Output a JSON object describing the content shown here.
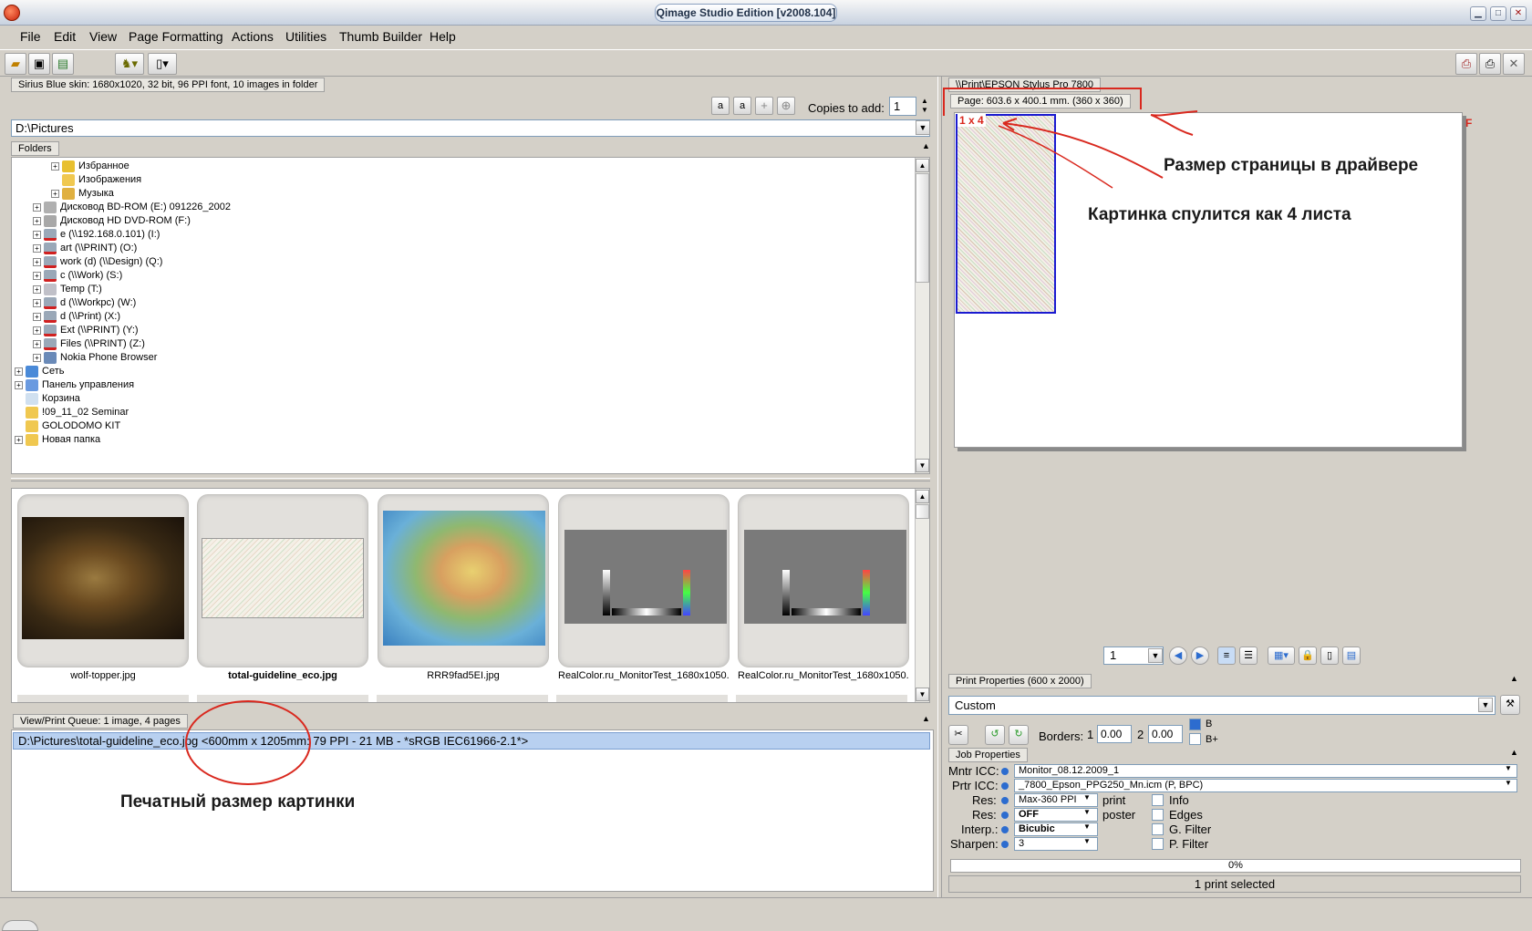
{
  "window": {
    "title": "Qimage Studio Edition [v2008.104]"
  },
  "menu": [
    "File",
    "Edit",
    "View",
    "Page Formatting",
    "Actions",
    "Utilities",
    "Thumb Builder",
    "Help"
  ],
  "status_tab": "Sirius Blue skin: 1680x1020, 32 bit, 96 PPI font, 10 images in folder",
  "copies": {
    "label": "Copies to add:",
    "value": "1"
  },
  "path": "D:\\Pictures",
  "folders": {
    "tab": "Folders",
    "items": [
      {
        "label": "Избранное",
        "icon": "star-folder-icon"
      },
      {
        "label": "Изображения",
        "icon": "folder-icon"
      },
      {
        "label": "Музыка",
        "icon": "music-folder-icon"
      },
      {
        "label": "Дисковод BD-ROM (E:) 091226_2002",
        "icon": "cd-drive-icon"
      },
      {
        "label": "Дисковод HD DVD-ROM (F:)",
        "icon": "dvd-drive-icon"
      },
      {
        "label": "e (\\\\192.168.0.101) (I:)",
        "icon": "network-drive-icon"
      },
      {
        "label": "art (\\\\PRINT) (O:)",
        "icon": "network-drive-icon"
      },
      {
        "label": "work (d) (\\\\Design) (Q:)",
        "icon": "network-drive-icon"
      },
      {
        "label": "c (\\\\Work) (S:)",
        "icon": "network-drive-icon"
      },
      {
        "label": "Temp (T:)",
        "icon": "drive-icon"
      },
      {
        "label": "d (\\\\Workpc) (W:)",
        "icon": "network-drive-icon"
      },
      {
        "label": "d (\\\\Print) (X:)",
        "icon": "network-drive-icon"
      },
      {
        "label": "Ext (\\\\PRINT) (Y:)",
        "icon": "network-drive-icon"
      },
      {
        "label": "Files (\\\\PRINT) (Z:)",
        "icon": "network-drive-icon"
      },
      {
        "label": "Nokia Phone Browser",
        "icon": "phone-icon"
      },
      {
        "label": "Сеть",
        "icon": "network-icon"
      },
      {
        "label": "Панель управления",
        "icon": "control-panel-icon"
      },
      {
        "label": "Корзина",
        "icon": "recycle-bin-icon"
      },
      {
        "label": "!09_11_02 Seminar",
        "icon": "folder-icon"
      },
      {
        "label": "GOLODOMO KIT",
        "icon": "folder-icon"
      },
      {
        "label": "Новая папка",
        "icon": "folder-icon"
      }
    ]
  },
  "thumbnails": [
    {
      "caption": "wolf-topper.jpg",
      "bold": false
    },
    {
      "caption": "total-guideline_eco.jpg",
      "bold": true
    },
    {
      "caption": "RRR9fad5EI.jpg",
      "bold": false
    },
    {
      "caption": "RealColor.ru_MonitorTest_1680x1050....",
      "bold": false
    },
    {
      "caption": "RealColor.ru_MonitorTest_1680x1050....",
      "bold": false
    }
  ],
  "queue": {
    "tab": "View/Print Queue: 1 image, 4 pages",
    "row": "D:\\Pictures\\total-guideline_eco.jpg <600mm x 1205mm:   79 PPI -  21 MB - *sRGB IEC61966-2.1*>"
  },
  "annotations": {
    "print_size": "Печатный размер картинки",
    "page_size": "Размер страницы в драйвере",
    "spool": "Картинка спулится как 4 листа"
  },
  "printer": {
    "tab": "\\\\Print\\EPSON Stylus Pro 7800",
    "page_info": "Page: 603.6 x 400.1 mm.  (360 x 360)",
    "tile_label": "1 x 4",
    "page_number": "1",
    "corner_marker": "F"
  },
  "print_props": {
    "tab": "Print Properties (600 x 2000)",
    "preset": "Custom",
    "borders_label": "Borders:",
    "border1_label": "1",
    "border1": "0.00",
    "border2_label": "2",
    "border2": "0.00",
    "check_b": "B",
    "check_bplus": "B+"
  },
  "job": {
    "tab": "Job Properties",
    "mntr_label": "Mntr ICC:",
    "mntr_value": "Monitor_08.12.2009_1",
    "prtr_label": "Prtr ICC:",
    "prtr_value": "_7800_Epson_PPG250_Mn.icm (P, BPC)",
    "res1_label": "Res:",
    "res1_value": "Max-360 PPI",
    "res1_suffix": "print",
    "res2_label": "Res:",
    "res2_value": "OFF",
    "res2_suffix": "poster",
    "interp_label": "Interp.:",
    "interp_value": "Bicubic",
    "sharpen_label": "Sharpen:",
    "sharpen_value": "3",
    "checks": [
      "Info",
      "Edges",
      "G. Filter",
      "P. Filter"
    ]
  },
  "progress": {
    "text": "0%",
    "value": 0
  },
  "status": "1 print selected",
  "colors": {
    "accent": "#2c6ccf",
    "annotation_red": "#d9281e",
    "selection": "#b8d0f0"
  }
}
